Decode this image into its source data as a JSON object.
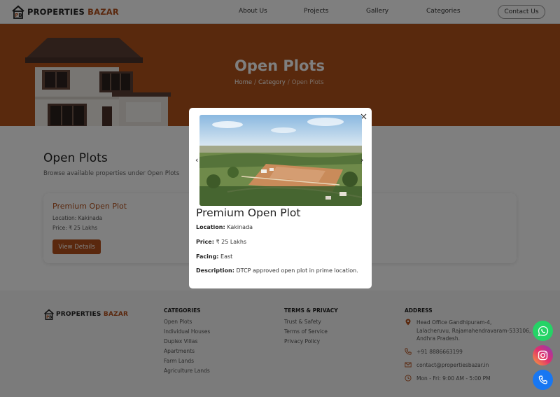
{
  "brand": {
    "name_part1": "PROPERTIES",
    "name_part2": "BAZAR"
  },
  "nav": {
    "items": [
      "About Us",
      "Projects",
      "Gallery",
      "Categories"
    ],
    "contact": "Contact Us"
  },
  "hero": {
    "title": "Open Plots",
    "breadcrumb": [
      "Home",
      "Category",
      "Open Plots"
    ]
  },
  "main": {
    "title": "Open Plots",
    "subtitle": "Browse available properties under Open Plots",
    "card": {
      "title": "Premium Open Plot",
      "location": "Location: Kakinada",
      "price": "Price: ₹ 25 Lakhs",
      "button": "View Details"
    }
  },
  "modal": {
    "title": "Premium Open Plot",
    "location_label": "Location:",
    "location": "Kakinada",
    "price_label": "Price:",
    "price": "₹ 25 Lakhs",
    "facing_label": "Facing:",
    "facing": "East",
    "desc_label": "Description:",
    "desc": "DTCP approved open plot in prime location.",
    "prev": "‹",
    "next": "›"
  },
  "footer": {
    "categories_title": "CATEGORIES",
    "categories": [
      "Open Plots",
      "Individual Houses",
      "Duplex Villas",
      "Apartments",
      "Farm Lands",
      "Agriculture Lands"
    ],
    "terms_title": "TERMS & PRIVACY",
    "terms": [
      "Trust & Safety",
      "Terms of Service",
      "Privacy Policy"
    ],
    "address_title": "ADDRESS",
    "address_lines": [
      "Head Office Gandhipuram-4,",
      "Lalacheruvu, Rajamahendravaram-533106,",
      "Andhra Pradesh."
    ],
    "phone": "+91 8886663199",
    "email": "contact@propertiesbazar.in",
    "hours": "Mon - Fri: 9:00 AM - 5:00 PM"
  },
  "colors": {
    "accent": "#b5511c",
    "hero_bg": "#b2531b",
    "whatsapp": "#25d366",
    "phone": "#1877f2"
  }
}
